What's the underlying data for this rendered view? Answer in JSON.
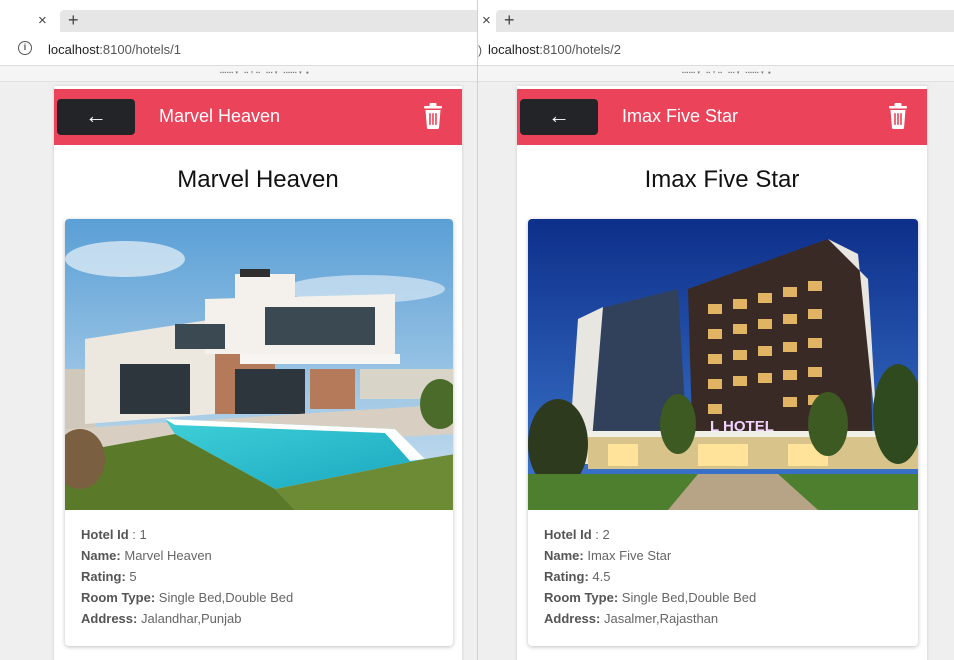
{
  "windows": [
    {
      "url_host": "localhost",
      "url_rest": ":8100/hotels/1",
      "toolbar_title": "Marvel Heaven",
      "page_title": "Marvel Heaven",
      "details": {
        "id_label": "Hotel Id",
        "id_value": " : 1",
        "name_label": "Name:",
        "name_value": " Marvel Heaven",
        "rating_label": "Rating:",
        "rating_value": " 5",
        "room_label": "Room Type:",
        "room_value": " Single Bed,Double Bed",
        "address_label": "Address:",
        "address_value": " Jalandhar,Punjab"
      }
    },
    {
      "url_host": "localhost",
      "url_rest": ":8100/hotels/2",
      "toolbar_title": "Imax Five Star",
      "page_title": "Imax Five Star",
      "hotel_sign": "L HOTEL",
      "details": {
        "id_label": "Hotel Id",
        "id_value": " : 2",
        "name_label": "Name:",
        "name_value": " Imax Five Star",
        "rating_label": "Rating:",
        "rating_value": " 4.5",
        "room_label": "Room Type:",
        "room_value": " Single Bed,Double Bed",
        "address_label": "Address:",
        "address_value": " Jasalmer,Rajasthan"
      }
    }
  ],
  "icons": {
    "close_tab": "×",
    "new_tab": "+",
    "back_arrow": "←",
    "info": "i",
    "paren": ")"
  },
  "colors": {
    "toolbar": "#eb445a",
    "back_button": "#222428"
  }
}
